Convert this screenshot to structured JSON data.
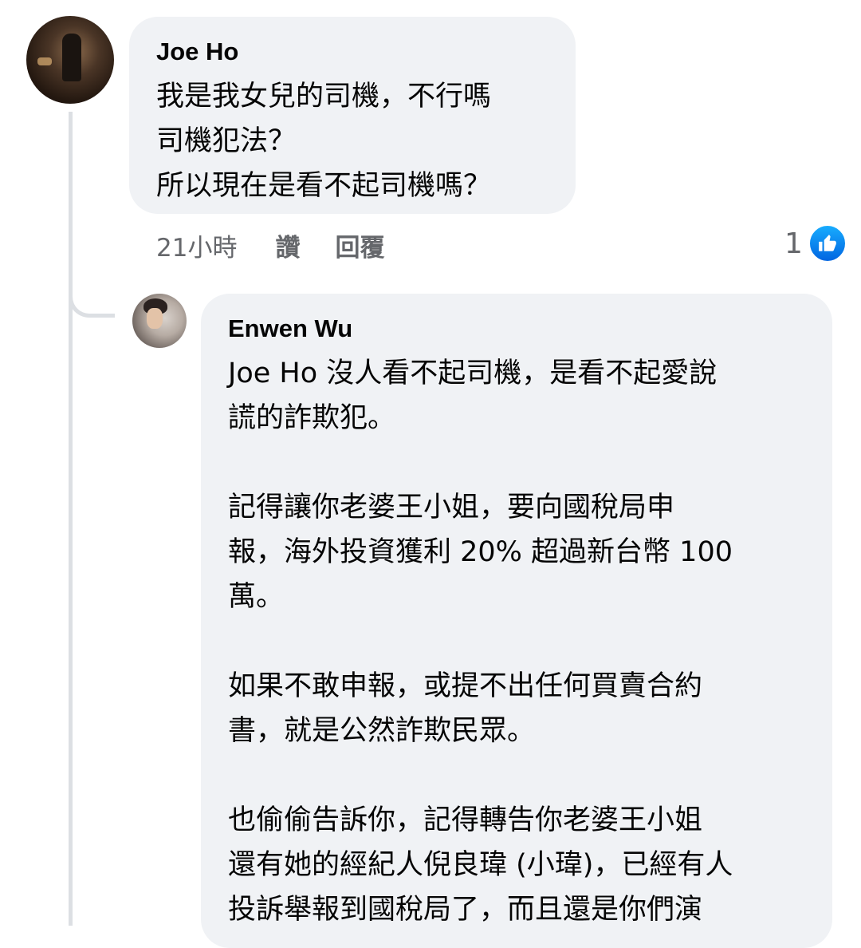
{
  "comment_joe": {
    "author": "Joe Ho",
    "lines": [
      "我是我女兒的司機，不行嗎",
      "司機犯法？",
      "所以現在是看不起司機嗎？"
    ],
    "time": "21小時",
    "like_action": "讚",
    "reply_action": "回覆",
    "reaction_count": "1",
    "reaction_icon": "like-icon"
  },
  "comment_enwen": {
    "author": "Enwen Wu",
    "lines": [
      "Joe Ho 沒人看不起司機，是看不起愛說",
      "謊的詐欺犯。",
      "",
      "記得讓你老婆王小姐，要向國稅局申",
      "報，海外投資獲利 20% 超過新台幣 100",
      "萬。",
      "",
      "如果不敢申報，或提不出任何買賣合約",
      "書，就是公然詐欺民眾。",
      "",
      "也偷偷告訴你，記得轉告你老婆王小姐",
      "還有她的經紀人倪良瑋 (小瑋)，已經有人",
      "投訴舉報到國稅局了，而且還是你們演"
    ]
  },
  "colors": {
    "bubble_bg": "#f0f2f5",
    "meta_text": "#65676b",
    "like_blue": "#0866ff",
    "thread_line": "#dcdfe3"
  }
}
